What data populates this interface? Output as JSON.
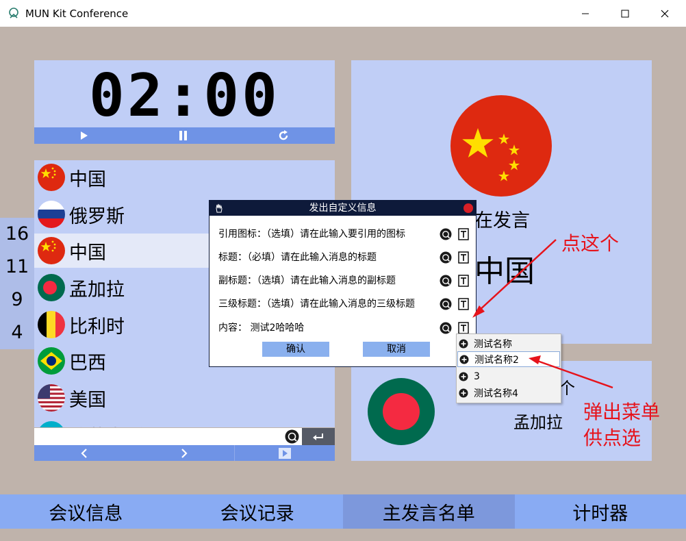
{
  "window": {
    "title": "MUN Kit Conference",
    "min_glyph": "—",
    "max_glyph": "☐",
    "close_glyph": "✕"
  },
  "timer": {
    "display": "02:00"
  },
  "countries": [
    {
      "name": "中国",
      "flag": "china",
      "selected": false
    },
    {
      "name": "俄罗斯",
      "flag": "russia",
      "selected": false
    },
    {
      "name": "中国",
      "flag": "china",
      "selected": true
    },
    {
      "name": "孟加拉",
      "flag": "bangladesh",
      "selected": false
    },
    {
      "name": "比利时",
      "flag": "belgium",
      "selected": false
    },
    {
      "name": "巴西",
      "flag": "brazil",
      "selected": false
    },
    {
      "name": "美国",
      "flag": "usa",
      "selected": false
    },
    {
      "name": "哈萨克斯坦",
      "flag": "kazakhstan",
      "selected": false
    }
  ],
  "numbers": [
    "16",
    "11",
    "9",
    "4"
  ],
  "speaker": {
    "status": "在发言",
    "country": "中国",
    "flag": "china"
  },
  "next": {
    "label": "个",
    "country": "孟加拉",
    "flag": "bangladesh"
  },
  "tabs": [
    {
      "label": "会议信息",
      "active": false
    },
    {
      "label": "会议记录",
      "active": false
    },
    {
      "label": "主发言名单",
      "active": true
    },
    {
      "label": "计时器",
      "active": false
    }
  ],
  "dialog": {
    "title": "发出自定义信息",
    "rows": [
      "引用图标：（选填）请在此输入要引用的图标",
      "标题：（必填）请在此输入消息的标题",
      "副标题：（选填）请在此输入消息的副标题",
      "三级标题：（选填）请在此输入消息的三级标题",
      "内容：  测试2哈哈哈"
    ],
    "confirm": "确认",
    "cancel": "取消"
  },
  "popup_menu": {
    "items": [
      "测试名称",
      "测试名称2",
      "3",
      "测试名称4"
    ],
    "hovered_index": 1
  },
  "annotations": {
    "click_this": "点这个",
    "popup_line1": "弹出菜单",
    "popup_line2": "供点选"
  },
  "colors": {
    "panel": "#c0cef6",
    "accent_bar": "#6f93e6",
    "tab_bar": "#89abf3",
    "tab_active": "#7d98dc",
    "dialog_header": "#0e1a3a",
    "annotation_red": "#e6131b"
  }
}
